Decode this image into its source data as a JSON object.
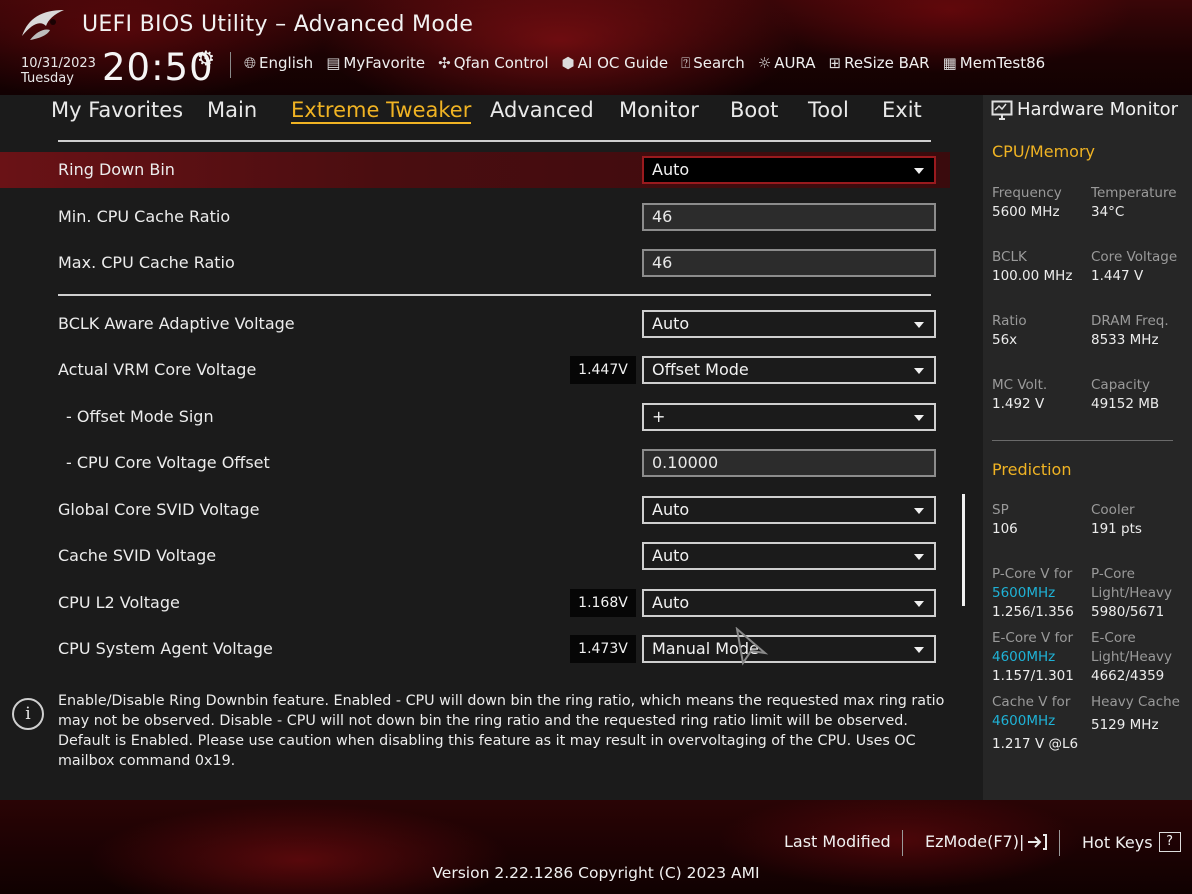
{
  "header": {
    "title": "UEFI BIOS Utility – Advanced Mode",
    "date": "10/31/2023",
    "day": "Tuesday",
    "time": "20:50",
    "tools": [
      {
        "label": "English",
        "icon": "globe-icon"
      },
      {
        "label": "MyFavorite",
        "icon": "favorite-icon"
      },
      {
        "label": "Qfan Control",
        "icon": "fan-icon"
      },
      {
        "label": "AI OC Guide",
        "icon": "ai-guide-icon"
      },
      {
        "label": "Search",
        "icon": "search-icon"
      },
      {
        "label": "AURA",
        "icon": "aura-icon"
      },
      {
        "label": "ReSize BAR",
        "icon": "resize-bar-icon"
      },
      {
        "label": "MemTest86",
        "icon": "memtest-icon"
      }
    ]
  },
  "tabs": [
    "My Favorites",
    "Main",
    "Extreme Tweaker",
    "Advanced",
    "Monitor",
    "Boot",
    "Tool",
    "Exit"
  ],
  "active_tab": "Extreme Tweaker",
  "settings": [
    {
      "label": "Ring Down Bin",
      "value": "Auto",
      "type": "select",
      "selected": true
    },
    {
      "label": "Min. CPU Cache Ratio",
      "value": "46",
      "type": "input"
    },
    {
      "label": "Max. CPU Cache Ratio",
      "value": "46",
      "type": "input"
    },
    {
      "label": "BCLK Aware Adaptive Voltage",
      "value": "Auto",
      "type": "select"
    },
    {
      "label": "Actual VRM Core Voltage",
      "value": "Offset Mode",
      "type": "select",
      "reading": "1.447V"
    },
    {
      "label": "- Offset Mode Sign",
      "value": "+",
      "type": "select"
    },
    {
      "label": "- CPU Core Voltage Offset",
      "value": "0.10000",
      "type": "input"
    },
    {
      "label": "Global Core SVID Voltage",
      "value": "Auto",
      "type": "select"
    },
    {
      "label": "Cache SVID Voltage",
      "value": "Auto",
      "type": "select"
    },
    {
      "label": "CPU L2 Voltage",
      "value": "Auto",
      "type": "select",
      "reading": "1.168V"
    },
    {
      "label": "CPU System Agent Voltage",
      "value": "Manual Mode",
      "type": "select",
      "reading": "1.473V"
    }
  ],
  "help": {
    "text": "Enable/Disable Ring Downbin feature. Enabled - CPU will down bin the ring ratio, which means the requested max ring ratio may not be observed. Disable - CPU will not down bin the ring ratio and the requested ring ratio limit will be observed. Default is Enabled. Please use caution when disabling this feature as it may result in overvoltaging of the CPU. Uses OC mailbox command 0x19."
  },
  "hardware_monitor": {
    "title": "Hardware Monitor",
    "cpu_memory": {
      "heading": "CPU/Memory",
      "frequency_label": "Frequency",
      "frequency": "5600 MHz",
      "temperature_label": "Temperature",
      "temperature": "34°C",
      "bclk_label": "BCLK",
      "bclk": "100.00 MHz",
      "core_voltage_label": "Core Voltage",
      "core_voltage": "1.447 V",
      "ratio_label": "Ratio",
      "ratio": "56x",
      "dram_freq_label": "DRAM Freq.",
      "dram_freq": "8533 MHz",
      "mc_volt_label": "MC Volt.",
      "mc_volt": "1.492 V",
      "capacity_label": "Capacity",
      "capacity": "49152 MB"
    },
    "prediction": {
      "heading": "Prediction",
      "sp_label": "SP",
      "sp": "106",
      "cooler_label": "Cooler",
      "cooler": "191 pts",
      "pcore_v_label": "P-Core V for",
      "pcore_freq": "5600MHz",
      "pcore_v": "1.256/1.356",
      "pcore_lh_label_1": "P-Core",
      "pcore_lh_label_2": "Light/Heavy",
      "pcore_lh": "5980/5671",
      "ecore_v_label": "E-Core V for",
      "ecore_freq": "4600MHz",
      "ecore_v": "1.157/1.301",
      "ecore_lh_label_1": "E-Core",
      "ecore_lh_label_2": "Light/Heavy",
      "ecore_lh": "4662/4359",
      "cache_v_label": "Cache V for",
      "cache_freq": "4600MHz",
      "cache_v": "1.217 V @L6",
      "heavy_cache_label": "Heavy Cache",
      "heavy_cache": "5129 MHz"
    }
  },
  "footer": {
    "last_modified": "Last Modified",
    "ezmode": "EzMode(F7)|",
    "hot_keys": "Hot Keys",
    "hot_keys_glyph": "?",
    "version": "Version 2.22.1286 Copyright (C) 2023 AMI"
  },
  "colors": {
    "accent": "#f0b323",
    "highlight_freq": "#1fb2d6",
    "selected_row": "#6a1216",
    "panel_bg": "#1b1b1b",
    "monitor_bg": "#262626"
  }
}
